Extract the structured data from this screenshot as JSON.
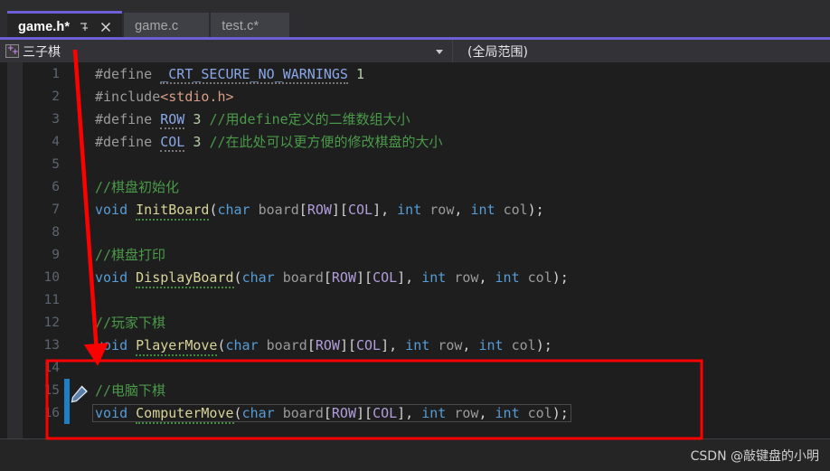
{
  "window": {
    "accent_purple": "#6d5fd5",
    "editor_bg": "#1e1e1e",
    "chrome_bg": "#2d2d30"
  },
  "tabs": [
    {
      "label": "game.h*",
      "active": true,
      "pin_icon": "pin-icon",
      "close_icon": "close-icon"
    },
    {
      "label": "game.c",
      "active": false
    },
    {
      "label": "test.c*",
      "active": false
    }
  ],
  "navbar": {
    "project_icon": "cpp-project-icon",
    "project_name": "三子棋",
    "scope_value": "(全局范围)",
    "dropdown_icon": "chevron-down-icon"
  },
  "code": {
    "language": "c-header",
    "lines": [
      {
        "n": "1",
        "changed": false,
        "text": "#define _CRT_SECURE_NO_WARNINGS 1"
      },
      {
        "n": "2",
        "changed": false,
        "text": "#include<stdio.h>"
      },
      {
        "n": "3",
        "changed": false,
        "text": "#define ROW 3 //用define定义的二维数组大小"
      },
      {
        "n": "4",
        "changed": false,
        "text": "#define COL 3 //在此处可以更方便的修改棋盘的大小"
      },
      {
        "n": "5",
        "changed": false,
        "text": ""
      },
      {
        "n": "6",
        "changed": false,
        "text": "//棋盘初始化"
      },
      {
        "n": "7",
        "changed": false,
        "text": "void InitBoard(char board[ROW][COL], int row, int col);"
      },
      {
        "n": "8",
        "changed": false,
        "text": ""
      },
      {
        "n": "9",
        "changed": false,
        "text": "//棋盘打印"
      },
      {
        "n": "10",
        "changed": false,
        "text": "void DisplayBoard(char board[ROW][COL], int row, int col);"
      },
      {
        "n": "11",
        "changed": false,
        "text": ""
      },
      {
        "n": "12",
        "changed": false,
        "text": "//玩家下棋"
      },
      {
        "n": "13",
        "changed": false,
        "text": "void PlayerMove(char board[ROW][COL], int row, int col);"
      },
      {
        "n": "14",
        "changed": false,
        "text": ""
      },
      {
        "n": "15",
        "changed": true,
        "text": "//电脑下棋"
      },
      {
        "n": "16",
        "changed": true,
        "text": "void ComputerMove(char board[ROW][COL], int row, int col);"
      }
    ]
  },
  "annotations": {
    "arrow_color": "#ff0000",
    "box_color": "#ff0000",
    "arrow_name": "red-pointer-arrow",
    "box_name": "red-highlight-box"
  },
  "watermark": {
    "text": "CSDN @敲键盘的小明"
  }
}
